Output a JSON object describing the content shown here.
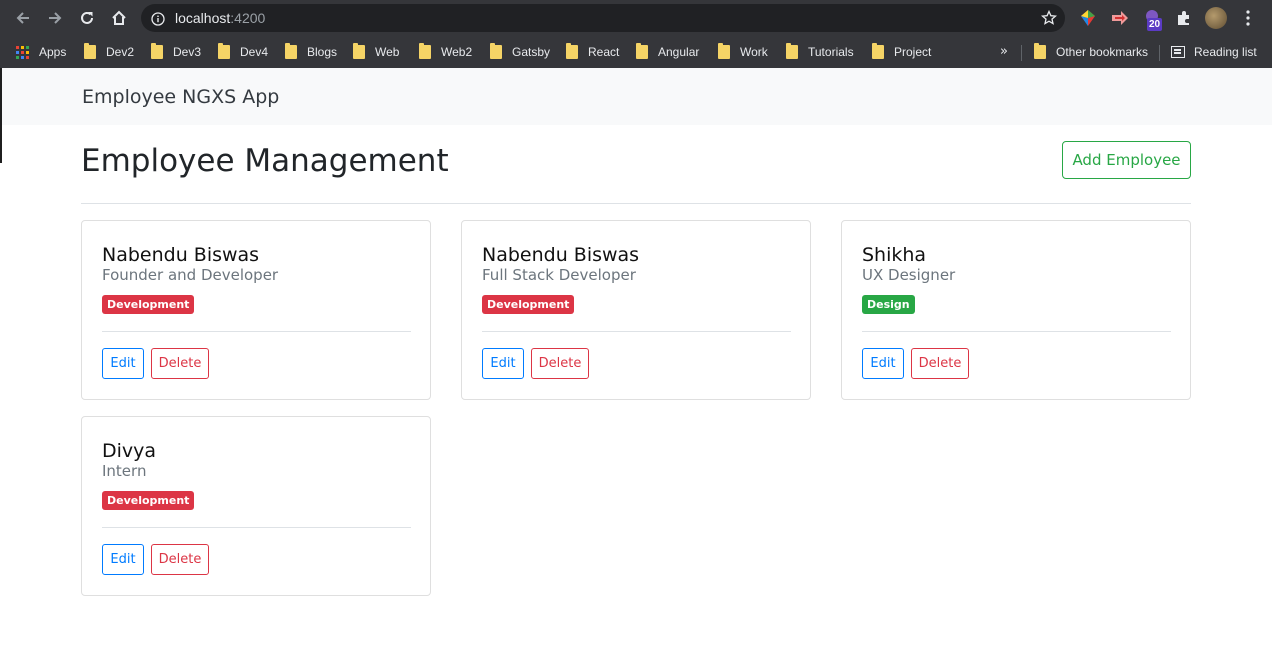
{
  "browser": {
    "url_host": "localhost",
    "url_port": ":4200",
    "extension_badge": "20",
    "icons": [
      "back-arrow-icon",
      "forward-arrow-icon",
      "reload-icon",
      "home-icon",
      "info-icon",
      "star-icon",
      "puzzle-icon",
      "menu-dots-icon"
    ],
    "bookmarks": [
      "Apps",
      "Dev2",
      "Dev3",
      "Dev4",
      "Blogs",
      "Web",
      "Web2",
      "Gatsby",
      "React",
      "Angular",
      "Work",
      "Tutorials",
      "Project"
    ],
    "overflow_label": "»",
    "other_bookmarks": "Other bookmarks",
    "reading_list": "Reading list"
  },
  "app": {
    "brand": "Employee NGXS App",
    "page_title": "Employee Management",
    "add_button": "Add Employee",
    "edit_label": "Edit",
    "delete_label": "Delete",
    "employees": [
      {
        "name": "Nabendu Biswas",
        "role": "Founder and Developer",
        "department": "Development"
      },
      {
        "name": "Nabendu Biswas",
        "role": "Full Stack Developer",
        "department": "Development"
      },
      {
        "name": "Shikha",
        "role": "UX Designer",
        "department": "Design"
      },
      {
        "name": "Divya",
        "role": "Intern",
        "department": "Development"
      }
    ]
  },
  "colors": {
    "development_badge": "#dc3545",
    "design_badge": "#28a745",
    "primary": "#007bff",
    "danger": "#dc3545",
    "success": "#28a745"
  }
}
